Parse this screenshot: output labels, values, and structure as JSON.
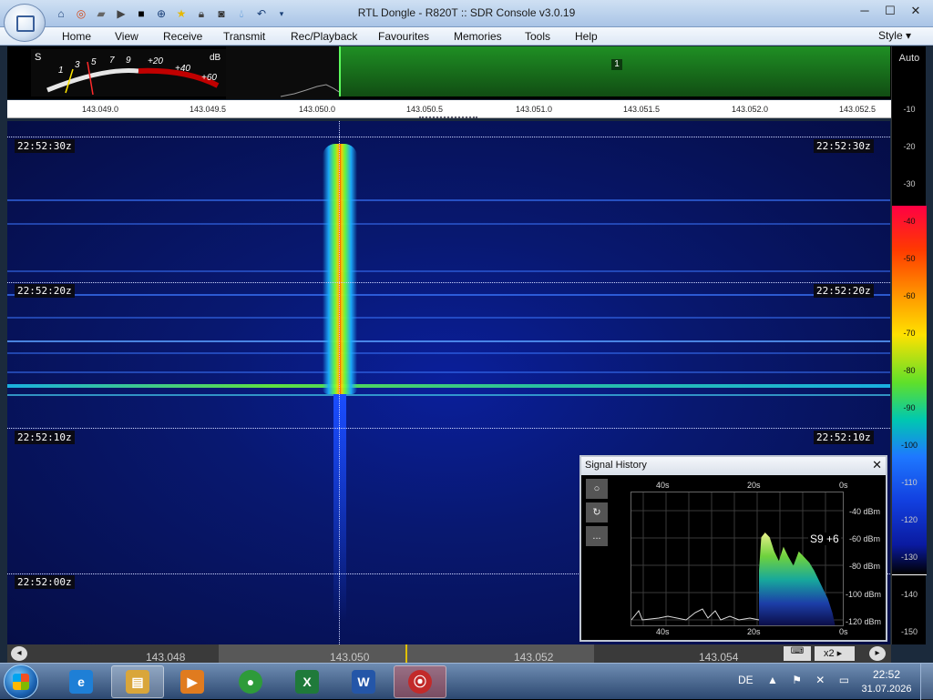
{
  "window": {
    "title": "RTL Dongle - R820T :: SDR Console v3.0.19",
    "controls": {
      "minimize": "─",
      "maximize": "☐",
      "close": "✕"
    }
  },
  "quick_access": [
    "home-icon",
    "lifebuoy-icon",
    "folder-icon",
    "play-icon",
    "stop-icon",
    "add-icon",
    "star-icon",
    "lock-icon",
    "camera-icon",
    "drop-icon",
    "undo-icon",
    "dropdown-icon"
  ],
  "menu": {
    "items": [
      "Home",
      "View",
      "Receive",
      "Transmit",
      "Rec/Playback",
      "Favourites",
      "Memories",
      "Tools",
      "Help"
    ],
    "style_label": "Style"
  },
  "smeter": {
    "s_label": "S",
    "db_label": "dB",
    "scale": [
      "1",
      "3",
      "5",
      "7",
      "9",
      "+20",
      "+40",
      "+60"
    ]
  },
  "band": {
    "number": "1"
  },
  "freq_top": [
    "143.049.0",
    "143.049.5",
    "143.050.0",
    "143.050.5",
    "143.051.0",
    "143.051.5",
    "143.052.0",
    "143.052.5"
  ],
  "waterfall": {
    "times": [
      "22:52:30z",
      "22:52:20z",
      "22:52:10z",
      "22:52:00z"
    ]
  },
  "right_scale": {
    "auto_label": "Auto",
    "values": [
      "-10",
      "-20",
      "-30",
      "-40",
      "-50",
      "-60",
      "-70",
      "-80",
      "-90",
      "-100",
      "-110",
      "-120",
      "-130",
      "-140",
      "-150"
    ]
  },
  "bottom_bar": {
    "freqs": [
      "143.048",
      "143.050",
      "143.052",
      "143.054"
    ],
    "zoom_label": "x2"
  },
  "signal_history": {
    "title": "Signal History",
    "close": "✕",
    "top_time_labels": [
      "40s",
      "20s",
      "0s"
    ],
    "bottom_time_labels": [
      "40s",
      "20s",
      "0s"
    ],
    "dbm_labels": [
      "-40 dBm",
      "-60 dBm",
      "-80 dBm",
      "-100 dBm",
      "-120 dBm"
    ],
    "reading": "S9 +6",
    "tools": [
      "○",
      "↻",
      "..."
    ]
  },
  "taskbar": {
    "apps": [
      {
        "name": "internet-explorer",
        "icon": "e",
        "color": "#1e7fd6"
      },
      {
        "name": "file-explorer",
        "icon": "▤",
        "color": "#d9a63a"
      },
      {
        "name": "media-player",
        "icon": "▶",
        "color": "#e07b1f"
      },
      {
        "name": "chrome",
        "icon": "●",
        "color": "#2e9b3a"
      },
      {
        "name": "excel",
        "icon": "X",
        "color": "#1f7a3a"
      },
      {
        "name": "word",
        "icon": "W",
        "color": "#2456a8"
      },
      {
        "name": "sdr-console",
        "icon": "⦿",
        "color": "#c22a2a"
      }
    ],
    "language": "DE",
    "tray_icons": "▲ ⚑ ✕ ▭",
    "time": "22:52",
    "date": "31.07.2026"
  }
}
